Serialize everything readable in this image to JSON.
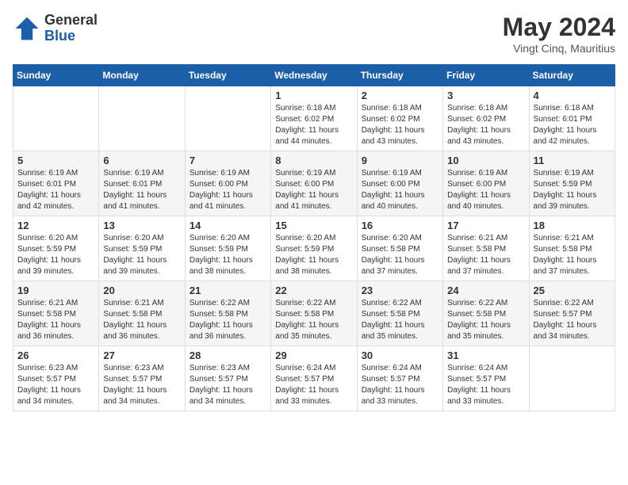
{
  "header": {
    "logo_general": "General",
    "logo_blue": "Blue",
    "month_title": "May 2024",
    "location": "Vingt Cinq, Mauritius"
  },
  "weekdays": [
    "Sunday",
    "Monday",
    "Tuesday",
    "Wednesday",
    "Thursday",
    "Friday",
    "Saturday"
  ],
  "weeks": [
    [
      {
        "day": "",
        "info": ""
      },
      {
        "day": "",
        "info": ""
      },
      {
        "day": "",
        "info": ""
      },
      {
        "day": "1",
        "info": "Sunrise: 6:18 AM\nSunset: 6:02 PM\nDaylight: 11 hours\nand 44 minutes."
      },
      {
        "day": "2",
        "info": "Sunrise: 6:18 AM\nSunset: 6:02 PM\nDaylight: 11 hours\nand 43 minutes."
      },
      {
        "day": "3",
        "info": "Sunrise: 6:18 AM\nSunset: 6:02 PM\nDaylight: 11 hours\nand 43 minutes."
      },
      {
        "day": "4",
        "info": "Sunrise: 6:18 AM\nSunset: 6:01 PM\nDaylight: 11 hours\nand 42 minutes."
      }
    ],
    [
      {
        "day": "5",
        "info": "Sunrise: 6:19 AM\nSunset: 6:01 PM\nDaylight: 11 hours\nand 42 minutes."
      },
      {
        "day": "6",
        "info": "Sunrise: 6:19 AM\nSunset: 6:01 PM\nDaylight: 11 hours\nand 41 minutes."
      },
      {
        "day": "7",
        "info": "Sunrise: 6:19 AM\nSunset: 6:00 PM\nDaylight: 11 hours\nand 41 minutes."
      },
      {
        "day": "8",
        "info": "Sunrise: 6:19 AM\nSunset: 6:00 PM\nDaylight: 11 hours\nand 41 minutes."
      },
      {
        "day": "9",
        "info": "Sunrise: 6:19 AM\nSunset: 6:00 PM\nDaylight: 11 hours\nand 40 minutes."
      },
      {
        "day": "10",
        "info": "Sunrise: 6:19 AM\nSunset: 6:00 PM\nDaylight: 11 hours\nand 40 minutes."
      },
      {
        "day": "11",
        "info": "Sunrise: 6:19 AM\nSunset: 5:59 PM\nDaylight: 11 hours\nand 39 minutes."
      }
    ],
    [
      {
        "day": "12",
        "info": "Sunrise: 6:20 AM\nSunset: 5:59 PM\nDaylight: 11 hours\nand 39 minutes."
      },
      {
        "day": "13",
        "info": "Sunrise: 6:20 AM\nSunset: 5:59 PM\nDaylight: 11 hours\nand 39 minutes."
      },
      {
        "day": "14",
        "info": "Sunrise: 6:20 AM\nSunset: 5:59 PM\nDaylight: 11 hours\nand 38 minutes."
      },
      {
        "day": "15",
        "info": "Sunrise: 6:20 AM\nSunset: 5:59 PM\nDaylight: 11 hours\nand 38 minutes."
      },
      {
        "day": "16",
        "info": "Sunrise: 6:20 AM\nSunset: 5:58 PM\nDaylight: 11 hours\nand 37 minutes."
      },
      {
        "day": "17",
        "info": "Sunrise: 6:21 AM\nSunset: 5:58 PM\nDaylight: 11 hours\nand 37 minutes."
      },
      {
        "day": "18",
        "info": "Sunrise: 6:21 AM\nSunset: 5:58 PM\nDaylight: 11 hours\nand 37 minutes."
      }
    ],
    [
      {
        "day": "19",
        "info": "Sunrise: 6:21 AM\nSunset: 5:58 PM\nDaylight: 11 hours\nand 36 minutes."
      },
      {
        "day": "20",
        "info": "Sunrise: 6:21 AM\nSunset: 5:58 PM\nDaylight: 11 hours\nand 36 minutes."
      },
      {
        "day": "21",
        "info": "Sunrise: 6:22 AM\nSunset: 5:58 PM\nDaylight: 11 hours\nand 36 minutes."
      },
      {
        "day": "22",
        "info": "Sunrise: 6:22 AM\nSunset: 5:58 PM\nDaylight: 11 hours\nand 35 minutes."
      },
      {
        "day": "23",
        "info": "Sunrise: 6:22 AM\nSunset: 5:58 PM\nDaylight: 11 hours\nand 35 minutes."
      },
      {
        "day": "24",
        "info": "Sunrise: 6:22 AM\nSunset: 5:58 PM\nDaylight: 11 hours\nand 35 minutes."
      },
      {
        "day": "25",
        "info": "Sunrise: 6:22 AM\nSunset: 5:57 PM\nDaylight: 11 hours\nand 34 minutes."
      }
    ],
    [
      {
        "day": "26",
        "info": "Sunrise: 6:23 AM\nSunset: 5:57 PM\nDaylight: 11 hours\nand 34 minutes."
      },
      {
        "day": "27",
        "info": "Sunrise: 6:23 AM\nSunset: 5:57 PM\nDaylight: 11 hours\nand 34 minutes."
      },
      {
        "day": "28",
        "info": "Sunrise: 6:23 AM\nSunset: 5:57 PM\nDaylight: 11 hours\nand 34 minutes."
      },
      {
        "day": "29",
        "info": "Sunrise: 6:24 AM\nSunset: 5:57 PM\nDaylight: 11 hours\nand 33 minutes."
      },
      {
        "day": "30",
        "info": "Sunrise: 6:24 AM\nSunset: 5:57 PM\nDaylight: 11 hours\nand 33 minutes."
      },
      {
        "day": "31",
        "info": "Sunrise: 6:24 AM\nSunset: 5:57 PM\nDaylight: 11 hours\nand 33 minutes."
      },
      {
        "day": "",
        "info": ""
      }
    ]
  ]
}
